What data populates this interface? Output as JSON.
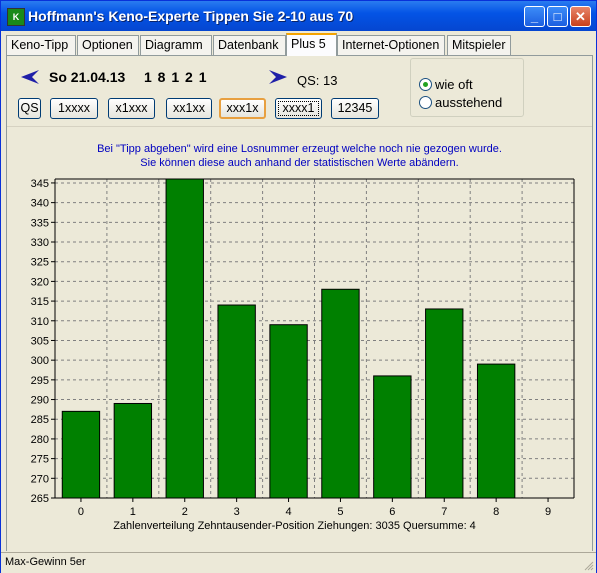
{
  "window": {
    "title": "Hoffmann's Keno-Experte  Tippen Sie 2-10 aus 70",
    "minimize": "_",
    "maximize": "□",
    "close": "✕"
  },
  "tabs": [
    {
      "label": "Keno-Tipp"
    },
    {
      "label": "Optionen"
    },
    {
      "label": "Diagramm"
    },
    {
      "label": "Datenbank"
    },
    {
      "label": "Plus 5",
      "active": true
    },
    {
      "label": "Internet-Optionen"
    },
    {
      "label": "Mitspieler"
    }
  ],
  "header": {
    "date": "So 21.04.13",
    "numbers": "1 8 1 2 1",
    "qs": "QS: 13"
  },
  "radio": {
    "option1": "wie oft",
    "option2": "ausstehend",
    "selected": "wie oft"
  },
  "position_buttons": [
    {
      "label": "QS"
    },
    {
      "label": "1xxxx"
    },
    {
      "label": "x1xxx"
    },
    {
      "label": "xx1xx"
    },
    {
      "label": "xxx1x",
      "selected": true
    },
    {
      "label": "xxxx1",
      "focused": true
    },
    {
      "label": "12345"
    }
  ],
  "info": {
    "line1": "Bei \"Tipp abgeben\" wird eine Losnummer erzeugt welche noch nie gezogen wurde.",
    "line2": "Sie können diese auch anhand der statistischen Werte abändern."
  },
  "chart_data": {
    "type": "bar",
    "categories": [
      "0",
      "1",
      "2",
      "3",
      "4",
      "5",
      "6",
      "7",
      "8",
      "9"
    ],
    "values": [
      287,
      289,
      346,
      314,
      309,
      318,
      296,
      313,
      299,
      null
    ],
    "ylim": [
      265,
      346
    ],
    "yticks": [
      265,
      270,
      275,
      280,
      285,
      290,
      295,
      300,
      305,
      310,
      315,
      320,
      325,
      330,
      335,
      340,
      345
    ],
    "xlabel": "Zahlenverteilung Zehntausender-Position   Ziehungen: 3035    Quersumme: 4",
    "bar_color": "#008000",
    "grid": true
  },
  "colors": {
    "title_bar": "#0454e6",
    "tab_highlight": "#f4a300",
    "info_text": "#0000c0",
    "bar": "#008000"
  },
  "status": {
    "text": "Max-Gewinn 5er"
  }
}
